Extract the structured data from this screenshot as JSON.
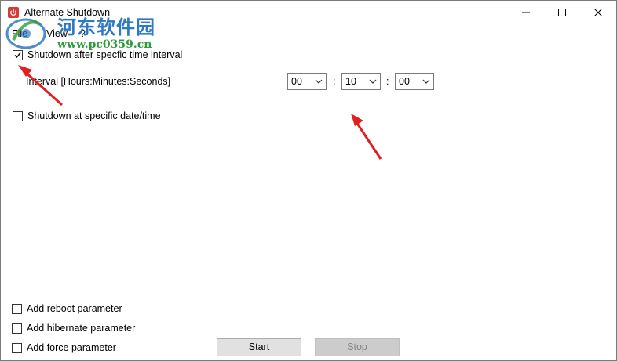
{
  "window": {
    "title": "Alternate Shutdown"
  },
  "menu": {
    "items": [
      "File",
      "View",
      "?"
    ]
  },
  "watermark": {
    "name": "河东软件园",
    "url": "www.pc0359.cn"
  },
  "interval_option": {
    "label": "Shutdown after specfic time interval",
    "checked": true
  },
  "interval": {
    "label": "Interval [Hours:Minutes:Seconds]",
    "hours": "00",
    "minutes": "10",
    "seconds": "00",
    "separator": ":"
  },
  "datetime_option": {
    "label": "Shutdown at specific date/time",
    "checked": false
  },
  "params": [
    {
      "label": "Add reboot parameter",
      "checked": false
    },
    {
      "label": "Add hibernate parameter",
      "checked": false
    },
    {
      "label": "Add force parameter",
      "checked": false
    }
  ],
  "buttons": {
    "start": "Start",
    "stop": "Stop"
  },
  "colors": {
    "annotation_arrow": "#e02020",
    "watermark_blue": "#2f78c4",
    "watermark_green": "#2f9a3a",
    "app_icon": "#d83b36"
  }
}
